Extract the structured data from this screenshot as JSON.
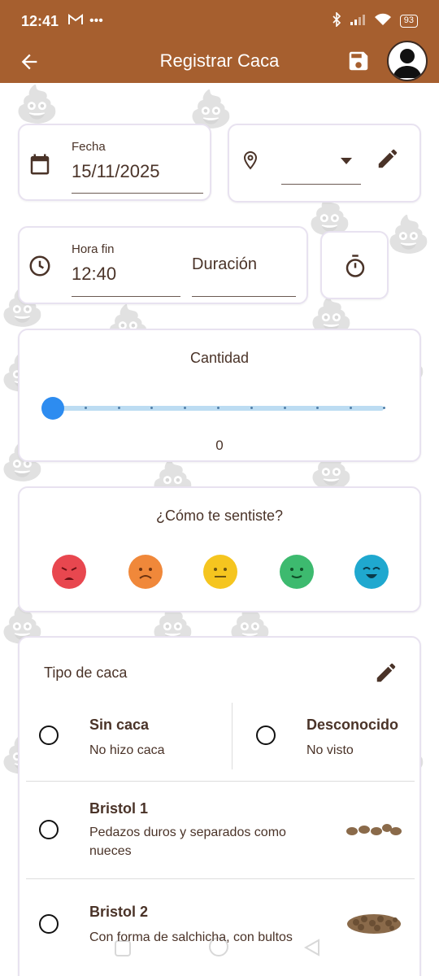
{
  "status_bar": {
    "time": "12:41",
    "battery": "93"
  },
  "app_bar": {
    "title": "Registrar Caca"
  },
  "date_card": {
    "label": "Fecha",
    "value": "15/11/2025"
  },
  "location_card": {
    "value": ""
  },
  "time_card": {
    "end_label": "Hora fin",
    "end_value": "12:40",
    "duration_label": "Duración"
  },
  "quantity_card": {
    "title": "Cantidad",
    "value": "0",
    "slider_fraction": 0
  },
  "mood_card": {
    "title": "¿Cómo te sentiste?",
    "moods": [
      {
        "icon": "angry-face-icon",
        "color": "#e8474f"
      },
      {
        "icon": "sad-face-icon",
        "color": "#f0883a"
      },
      {
        "icon": "neutral-face-icon",
        "color": "#f5c51f"
      },
      {
        "icon": "smile-face-icon",
        "color": "#3dba6f"
      },
      {
        "icon": "happy-face-icon",
        "color": "#1fa8cf"
      }
    ]
  },
  "type_card": {
    "title": "Tipo de caca",
    "options": [
      {
        "title": "Sin caca",
        "desc": "No hizo caca"
      },
      {
        "title": "Desconocido",
        "desc": "No visto"
      },
      {
        "title": "Bristol 1",
        "desc": "Pedazos duros y separados como nueces"
      },
      {
        "title": "Bristol 2",
        "desc": "Con forma de salchicha, con bultos"
      }
    ]
  },
  "colors": {
    "primary": "#a65f2f",
    "accent": "#2d8cf0",
    "text": "#4a3328"
  }
}
